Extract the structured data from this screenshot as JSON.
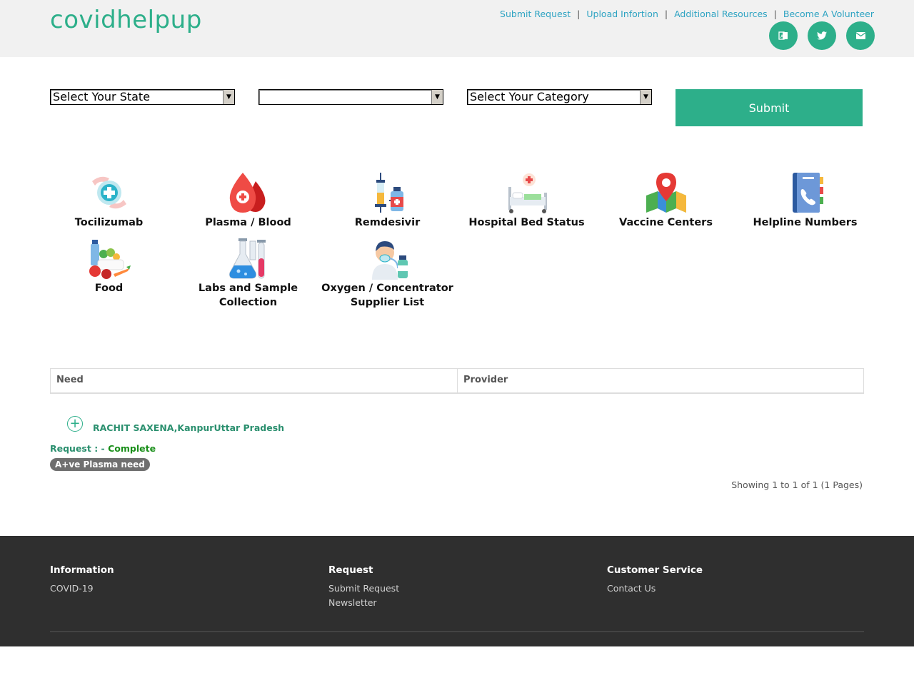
{
  "header": {
    "brand": "covidhelpup",
    "nav": [
      "Submit Request",
      "Upload Infortion",
      "Additional Resources",
      "Become A Volunteer"
    ],
    "nav_separator": "|",
    "social_icons": [
      "translate-icon",
      "twitter-icon",
      "email-icon"
    ]
  },
  "filters": {
    "state": "Select Your State",
    "city": "",
    "category": "Select Your Category",
    "submit_label": "Submit"
  },
  "categories": [
    {
      "label": "Tocilizumab",
      "icon": "hands-medical-icon"
    },
    {
      "label": "Plasma / Blood",
      "icon": "blood-drop-icon"
    },
    {
      "label": "Remdesivir",
      "icon": "syringe-vial-icon"
    },
    {
      "label": "Hospital Bed Status",
      "icon": "hospital-bed-icon"
    },
    {
      "label": "Vaccine Centers",
      "icon": "map-pin-icon"
    },
    {
      "label": "Helpline Numbers",
      "icon": "phone-book-icon"
    },
    {
      "label": "Food",
      "icon": "food-icon"
    },
    {
      "label": "Labs and Sample Collection",
      "icon": "lab-flask-icon"
    },
    {
      "label": "Oxygen / Concentrator Supplier List",
      "icon": "oxygen-patient-icon"
    }
  ],
  "table": {
    "headers": [
      "Need",
      "Provider"
    ]
  },
  "entry": {
    "name": "RACHIT SAXENA,KanpurUttar Pradesh",
    "request_label": "Request : - ",
    "request_status": "Complete",
    "badge": "A+ve Plasma need"
  },
  "pagination": "Showing 1 to 1 of 1 (1 Pages)",
  "footer": {
    "information": {
      "heading": "Information",
      "links": [
        "COVID-19"
      ]
    },
    "request": {
      "heading": "Request",
      "links": [
        "Submit Request",
        "Newsletter"
      ]
    },
    "customer_service": {
      "heading": "Customer Service",
      "links": [
        "Contact Us"
      ]
    }
  },
  "colors": {
    "accent": "#2daf8a",
    "link": "#2ea3c2",
    "footer_bg": "#2f2f2f",
    "header_bg": "#f1f1f1"
  }
}
